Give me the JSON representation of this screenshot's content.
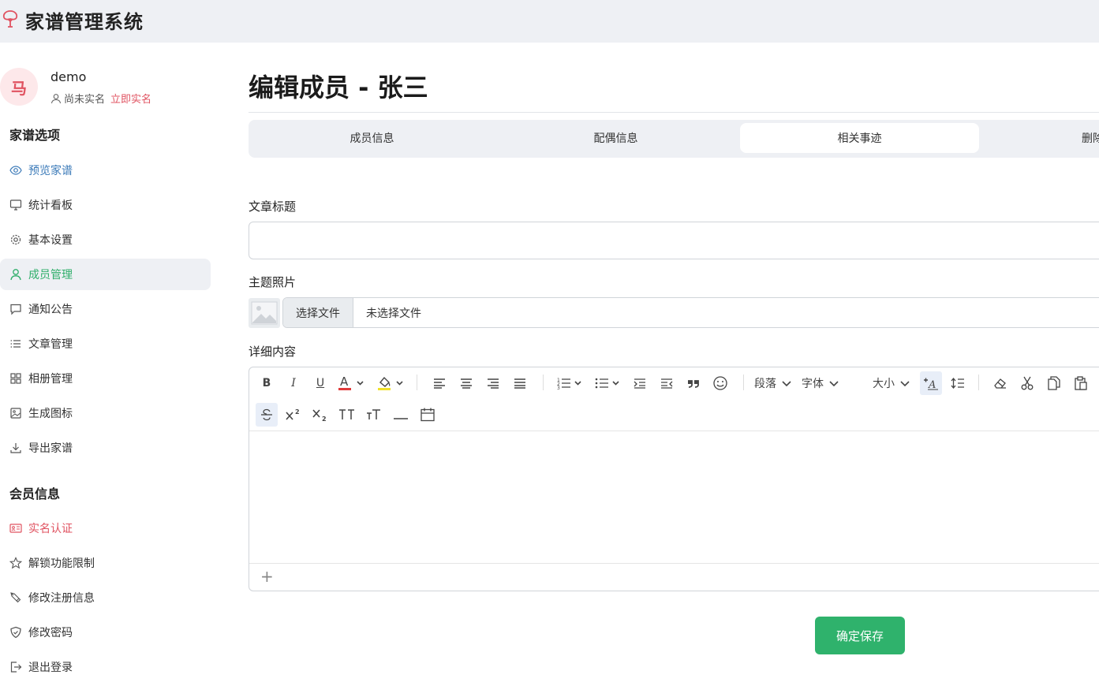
{
  "app": {
    "title": "家谱管理系统",
    "logo_icon": "tree-logo-icon",
    "brand_color": "#e05361",
    "accent_color": "#2fb26c"
  },
  "user": {
    "avatar_text": "马",
    "name": "demo",
    "verify_status": "尚未实名",
    "verify_link": "立即实名"
  },
  "sidebar": {
    "section1_title": "家谱选项",
    "items1": [
      {
        "label": "预览家谱",
        "icon": "eye-icon"
      },
      {
        "label": "统计看板",
        "icon": "monitor-icon"
      },
      {
        "label": "基本设置",
        "icon": "gear-icon"
      },
      {
        "label": "成员管理",
        "icon": "person-icon",
        "active": true
      },
      {
        "label": "通知公告",
        "icon": "chat-icon"
      },
      {
        "label": "文章管理",
        "icon": "list-icon"
      },
      {
        "label": "相册管理",
        "icon": "grid-icon"
      },
      {
        "label": "生成图标",
        "icon": "image-icon"
      },
      {
        "label": "导出家谱",
        "icon": "download-icon"
      }
    ],
    "section2_title": "会员信息",
    "items2": [
      {
        "label": "实名认证",
        "icon": "id-card-icon"
      },
      {
        "label": "解锁功能限制",
        "icon": "star-icon"
      },
      {
        "label": "修改注册信息",
        "icon": "pen-icon"
      },
      {
        "label": "修改密码",
        "icon": "shield-icon"
      },
      {
        "label": "退出登录",
        "icon": "logout-icon"
      }
    ]
  },
  "main": {
    "title": "编辑成员 - 张三",
    "tabs": [
      {
        "label": "成员信息"
      },
      {
        "label": "配偶信息"
      },
      {
        "label": "相关事迹",
        "active": true
      },
      {
        "label": "删除"
      }
    ],
    "article_title_label": "文章标题",
    "article_title_value": "",
    "photo_label": "主题照片",
    "file_button": "选择文件",
    "file_status": "未选择文件",
    "content_label": "详细内容",
    "toolbar": {
      "paragraph": "段落",
      "font": "字体",
      "size": "大小"
    },
    "save_button": "确定保存"
  }
}
